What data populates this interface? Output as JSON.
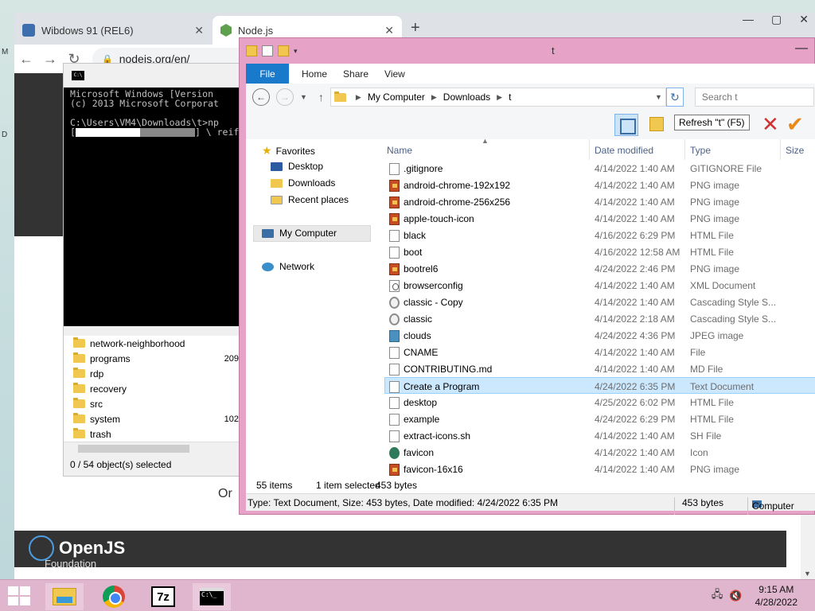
{
  "browser": {
    "tabs": [
      {
        "title": "Wibdows 91 (REL6)",
        "close": "✕"
      },
      {
        "title": "Node.js",
        "close": "✕"
      }
    ],
    "new_tab": "+",
    "window_buttons": {
      "minimize": "—",
      "maximize": "▢",
      "close": "✕"
    },
    "nav": {
      "back": "←",
      "forward": "→",
      "reload": "↻"
    },
    "address": "nodejs.org/en/",
    "page": {
      "footer_logo": "OpenJS",
      "footer_sub": "Foundation",
      "partial_text": "Or"
    }
  },
  "cmd": {
    "lines": [
      "Microsoft Windows [Version",
      "(c) 2013 Microsoft Corporat",
      "",
      "C:\\Users\\VM4\\Downloads\\t>np",
      "[",
      "] \\ reif"
    ]
  },
  "folder_window": {
    "folders": [
      {
        "name": "network-neighborhood",
        "size": ""
      },
      {
        "name": "programs",
        "size": "209"
      },
      {
        "name": "rdp",
        "size": ""
      },
      {
        "name": "recovery",
        "size": ""
      },
      {
        "name": "src",
        "size": ""
      },
      {
        "name": "system",
        "size": "102"
      },
      {
        "name": "trash",
        "size": ""
      }
    ],
    "status": "0 / 54 object(s) selected"
  },
  "explorer": {
    "title": "t",
    "minimize": "—",
    "ribbon_tabs": {
      "file": "File",
      "home": "Home",
      "share": "Share",
      "view": "View"
    },
    "breadcrumb": [
      "My Computer",
      "Downloads",
      "t"
    ],
    "search_placeholder": "Search t",
    "tooltip": "Refresh \"t\" (F5)",
    "nav_pane": {
      "favorites": "Favorites",
      "desktop": "Desktop",
      "downloads": "Downloads",
      "recent": "Recent places",
      "my_computer": "My Computer",
      "network": "Network"
    },
    "columns": {
      "name": "Name",
      "date": "Date modified",
      "type": "Type",
      "size": "Size"
    },
    "files": [
      {
        "name": ".gitignore",
        "date": "4/14/2022 1:40 AM",
        "type": "GITIGNORE File",
        "icon": "file"
      },
      {
        "name": "android-chrome-192x192",
        "date": "4/14/2022 1:40 AM",
        "type": "PNG image",
        "icon": "png"
      },
      {
        "name": "android-chrome-256x256",
        "date": "4/14/2022 1:40 AM",
        "type": "PNG image",
        "icon": "png"
      },
      {
        "name": "apple-touch-icon",
        "date": "4/14/2022 1:40 AM",
        "type": "PNG image",
        "icon": "png"
      },
      {
        "name": "black",
        "date": "4/16/2022 6:29 PM",
        "type": "HTML File",
        "icon": "file"
      },
      {
        "name": "boot",
        "date": "4/16/2022 12:58 AM",
        "type": "HTML File",
        "icon": "file"
      },
      {
        "name": "bootrel6",
        "date": "4/24/2022 2:46 PM",
        "type": "PNG image",
        "icon": "png"
      },
      {
        "name": "browserconfig",
        "date": "4/14/2022 1:40 AM",
        "type": "XML Document",
        "icon": "xml"
      },
      {
        "name": "classic - Copy",
        "date": "4/14/2022 1:40 AM",
        "type": "Cascading Style S...",
        "icon": "gear"
      },
      {
        "name": "classic",
        "date": "4/14/2022 2:18 AM",
        "type": "Cascading Style S...",
        "icon": "gear"
      },
      {
        "name": "clouds",
        "date": "4/24/2022 4:36 PM",
        "type": "JPEG image",
        "icon": "jpg"
      },
      {
        "name": "CNAME",
        "date": "4/14/2022 1:40 AM",
        "type": "File",
        "icon": "file"
      },
      {
        "name": "CONTRIBUTING.md",
        "date": "4/14/2022 1:40 AM",
        "type": "MD File",
        "icon": "file"
      },
      {
        "name": "Create a Program",
        "date": "4/24/2022 6:35 PM",
        "type": "Text Document",
        "icon": "file"
      },
      {
        "name": "desktop",
        "date": "4/25/2022 6:02 PM",
        "type": "HTML File",
        "icon": "file"
      },
      {
        "name": "example",
        "date": "4/24/2022 6:29 PM",
        "type": "HTML File",
        "icon": "file"
      },
      {
        "name": "extract-icons.sh",
        "date": "4/14/2022 1:40 AM",
        "type": "SH File",
        "icon": "file"
      },
      {
        "name": "favicon",
        "date": "4/14/2022 1:40 AM",
        "type": "Icon",
        "icon": "ico"
      },
      {
        "name": "favicon-16x16",
        "date": "4/14/2022 1:40 AM",
        "type": "PNG image",
        "icon": "png"
      }
    ],
    "selected_index": 13,
    "status": {
      "items": "55 items",
      "selected": "1 item selected",
      "size": "453 bytes"
    },
    "details": {
      "text": "Type: Text Document, Size: 453 bytes, Date modified: 4/24/2022 6:35 PM",
      "size": "453 bytes",
      "location": "Computer"
    }
  },
  "desktop_edge": {
    "top": "M",
    "mid": "D"
  },
  "taskbar": {
    "sevenzip": "7z",
    "cmd_glyph": "C:\\_",
    "time": "9:15 AM",
    "date": "4/28/2022"
  }
}
